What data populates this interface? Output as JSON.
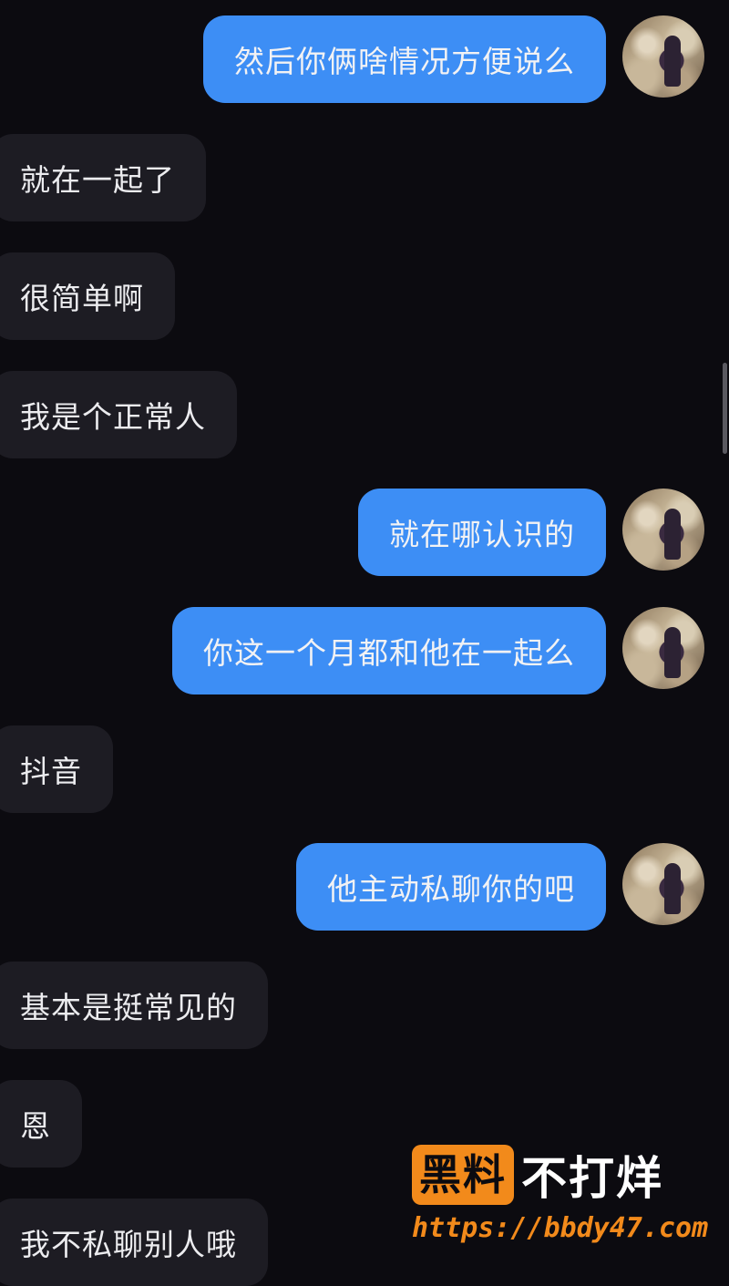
{
  "messages": [
    {
      "direction": "outgoing",
      "text": "然后你俩啥情况方便说么"
    },
    {
      "direction": "incoming",
      "text": "就在一起了"
    },
    {
      "direction": "incoming",
      "text": "很简单啊"
    },
    {
      "direction": "incoming",
      "text": "我是个正常人"
    },
    {
      "direction": "outgoing",
      "text": "就在哪认识的"
    },
    {
      "direction": "outgoing",
      "text": "你这一个月都和他在一起么"
    },
    {
      "direction": "incoming",
      "text": "抖音"
    },
    {
      "direction": "outgoing",
      "text": "他主动私聊你的吧"
    },
    {
      "direction": "incoming",
      "text": "基本是挺常见的"
    },
    {
      "direction": "incoming",
      "text": "恩"
    },
    {
      "direction": "incoming",
      "text": "我不私聊别人哦"
    }
  ],
  "watermark": {
    "badge": "黑料",
    "text": "不打烊",
    "url": "https://bbdy47.com"
  },
  "colors": {
    "background": "#0c0b10",
    "outgoing_bubble": "#3d8ef5",
    "incoming_bubble": "#1d1c23",
    "watermark_accent": "#f28a1b"
  },
  "icons": {
    "avatar": "user-avatar-photo"
  }
}
